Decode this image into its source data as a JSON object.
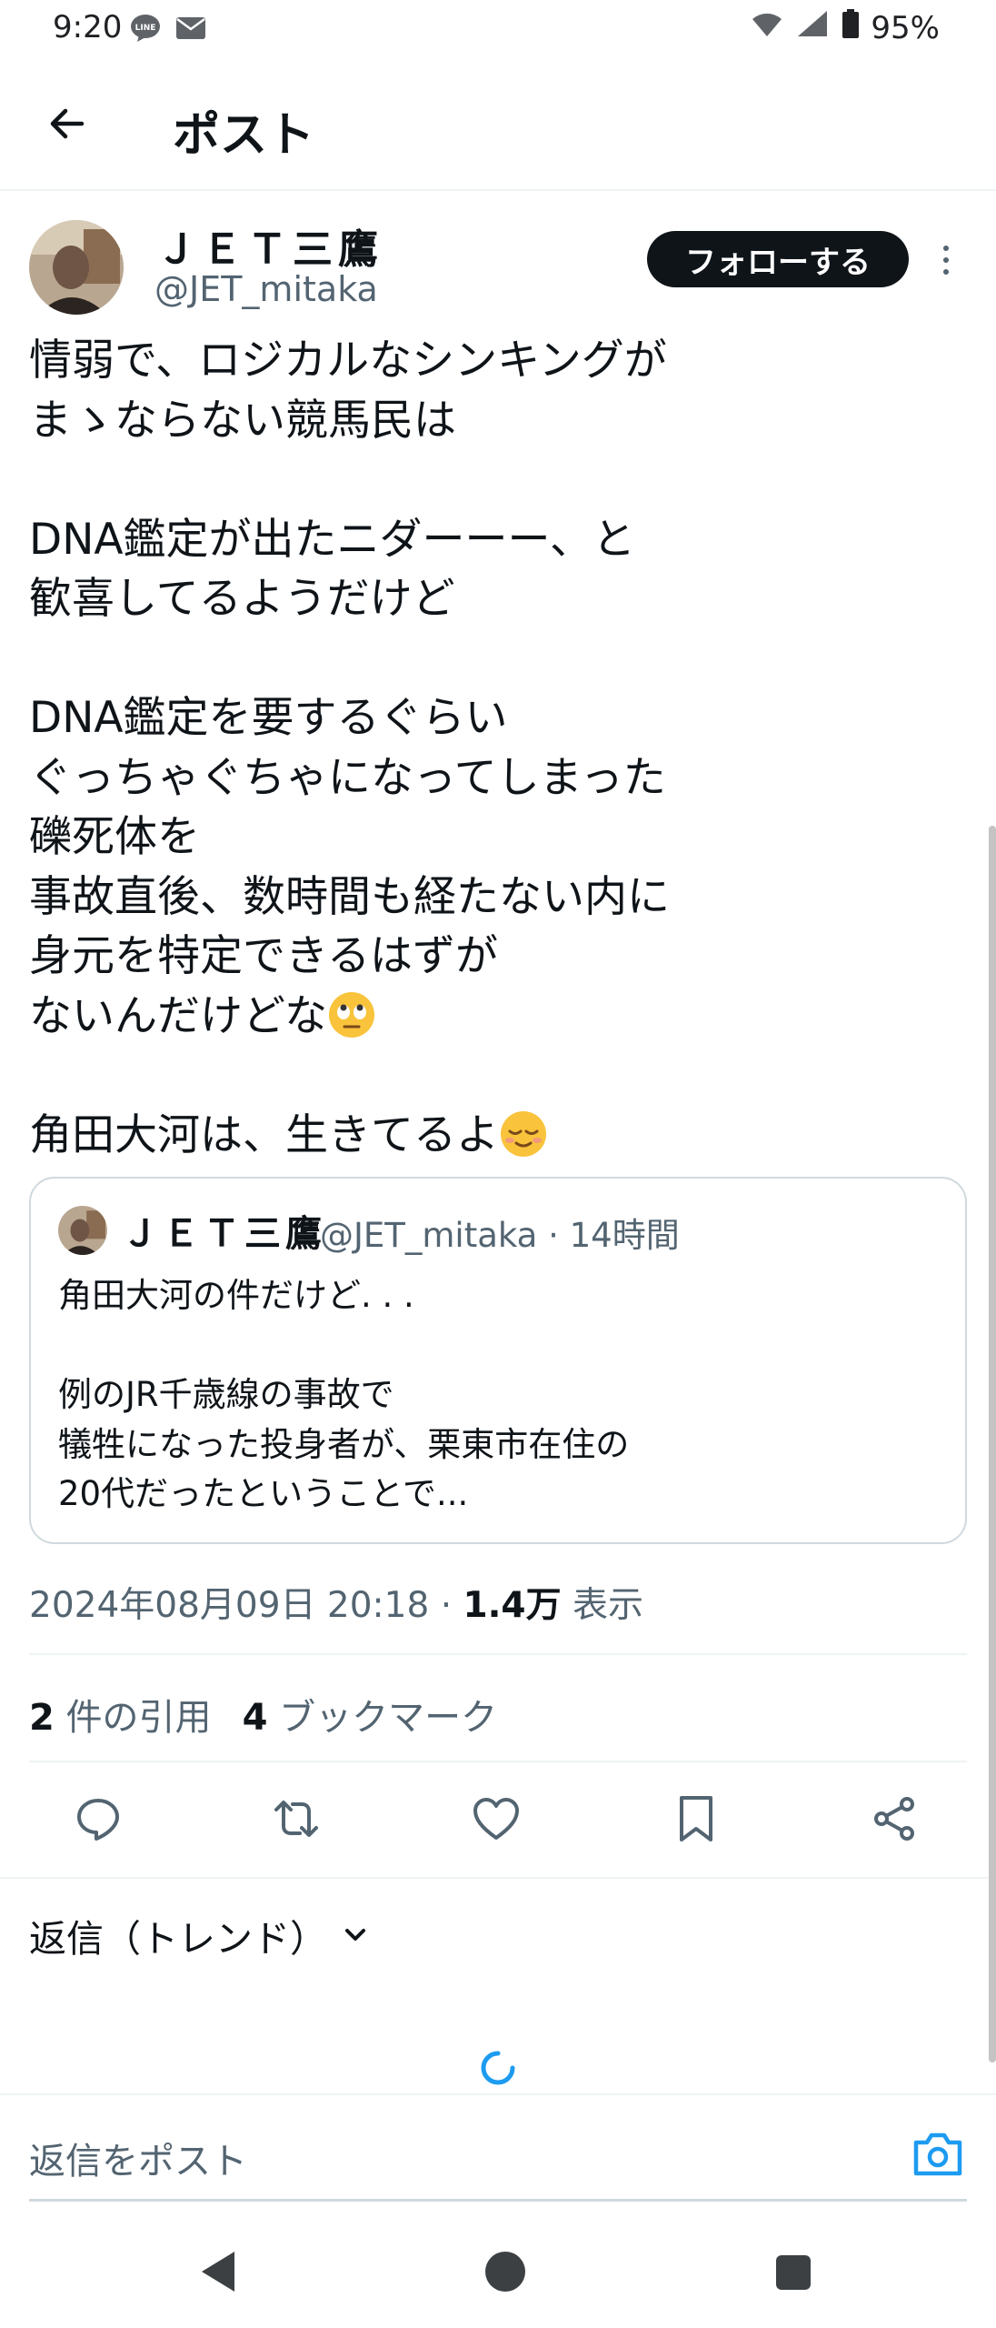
{
  "status_bar": {
    "time": "9:20",
    "left_icons": [
      "line-notification-icon",
      "mail-notification-icon"
    ],
    "right_icons": [
      "wifi-icon",
      "signal-icon",
      "battery-icon"
    ],
    "battery": "95%"
  },
  "header": {
    "title": "ポスト",
    "back_icon": "arrow-left-icon"
  },
  "post": {
    "author": {
      "display_name": "ＪＥＴ三鷹",
      "handle": "@JET_mitaka"
    },
    "follow_label": "フォローする",
    "text_main": "情弱で、ロジカルなシンキングが\nまゝならない競馬民は\n\nDNA鑑定が出たニダーーー、と\n歓喜してるようだけど\n\nDNA鑑定を要するぐらい\nぐっちゃぐちゃになってしまった\n礫死体を\n事故直後、数時間も経たない内に\n身元を特定できるはずが\nないんだけどな",
    "emoji_1": "face-with-rolling-eyes-emoji",
    "text_tail": "角田大河は、生きてるよ",
    "emoji_2": "relieved-face-emoji",
    "quote": {
      "display_name": "ＪＥＴ三鷹",
      "handle_time": "@JET_mitaka · 14時間",
      "text": "角田大河の件だけど. . .\n\n例のJR千歳線の事故で\n犠牲になった投身者が、栗東市在住の\n20代だったということで..."
    },
    "timestamp": "2024年08月09日 20:18 · ",
    "views_count": "1.4万",
    "views_label": " 表示",
    "quotes_count": "2",
    "quotes_label": " 件の引用",
    "bookmarks_count": "4",
    "bookmarks_label": " ブックマーク",
    "actions": [
      "reply-icon",
      "repost-icon",
      "like-icon",
      "bookmark-icon",
      "share-icon"
    ]
  },
  "replies": {
    "sort_label": "返信（トレンド）",
    "reply_placeholder": "返信をポスト"
  },
  "colors": {
    "accent": "#1d9bf0",
    "text": "#0f1419",
    "secondary": "#536471",
    "border": "#cfd9de"
  }
}
